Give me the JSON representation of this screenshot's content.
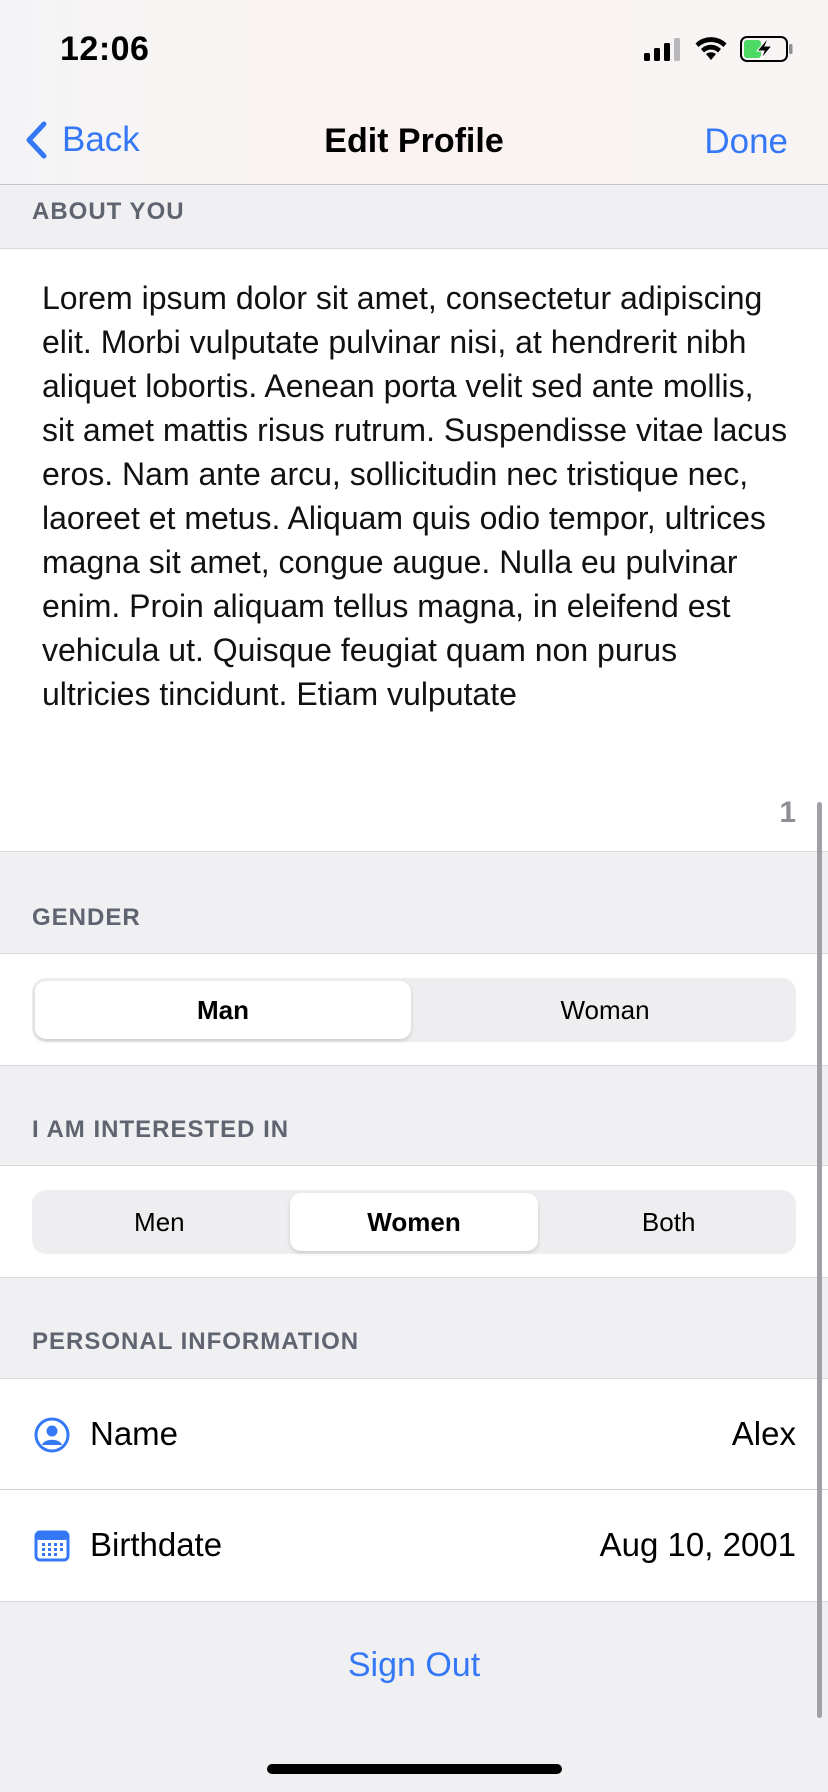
{
  "status_bar": {
    "time": "12:06"
  },
  "nav": {
    "back_label": "Back",
    "title": "Edit Profile",
    "done_label": "Done"
  },
  "about": {
    "header": "ABOUT YOU",
    "text": "Lorem ipsum dolor sit amet, consectetur adipiscing elit. Morbi vulputate pulvinar nisi, at hendrerit nibh aliquet lobortis. Aenean porta velit sed ante mollis, sit amet mattis risus rutrum. Suspendisse vitae lacus eros. Nam ante arcu, sollicitudin nec tristique nec, laoreet et metus. Aliquam quis odio tempor, ultrices magna sit amet, congue augue. Nulla eu pulvinar enim. Proin aliquam tellus magna, in eleifend est vehicula ut. Quisque feugiat quam non purus ultricies tincidunt. Etiam vulputate",
    "char_count": "1"
  },
  "gender": {
    "header": "GENDER",
    "options": [
      "Man",
      "Woman"
    ],
    "selected": "Man"
  },
  "interest": {
    "header": "I AM INTERESTED IN",
    "options": [
      "Men",
      "Women",
      "Both"
    ],
    "selected": "Women"
  },
  "personal": {
    "header": "PERSONAL INFORMATION",
    "rows": [
      {
        "label": "Name",
        "value": "Alex",
        "icon": "person-circle-icon"
      },
      {
        "label": "Birthdate",
        "value": "Aug 10, 2001",
        "icon": "calendar-icon"
      }
    ]
  },
  "sign_out_label": "Sign Out",
  "colors": {
    "accent": "#3478f6",
    "background": "#f0f0f3",
    "battery_green": "#4cd964"
  }
}
